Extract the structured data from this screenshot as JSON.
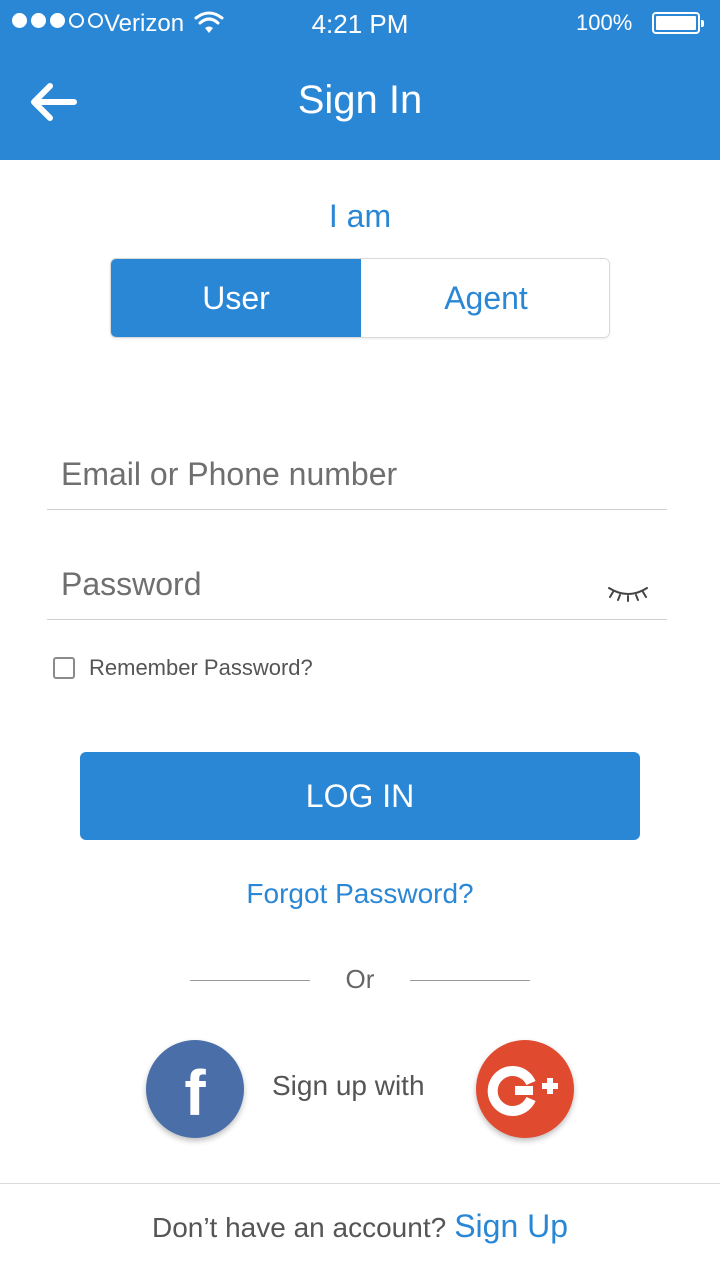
{
  "status_bar": {
    "carrier": "Verizon",
    "time": "4:21 PM",
    "battery": "100%",
    "signal_dots_filled": 3,
    "signal_dots_total": 5
  },
  "header": {
    "title": "Sign In",
    "back_icon": "back-arrow-icon"
  },
  "role_selector": {
    "label": "I am",
    "options": [
      "User",
      "Agent"
    ],
    "selected": "User"
  },
  "form": {
    "email_placeholder": "Email or Phone number",
    "password_placeholder": "Password",
    "remember_label": "Remember Password?",
    "remember_checked": false
  },
  "actions": {
    "login_label": "LOG IN",
    "forgot_label": "Forgot Password?"
  },
  "social": {
    "or_label": "Or",
    "signup_with_label": "Sign up with",
    "facebook_glyph": "f",
    "google_label": "G+"
  },
  "footer": {
    "question": "Don’t have an account?",
    "signup_link": "Sign Up"
  },
  "colors": {
    "primary": "#2a87d6",
    "facebook": "#4a6fa8",
    "google": "#e04a2f"
  }
}
